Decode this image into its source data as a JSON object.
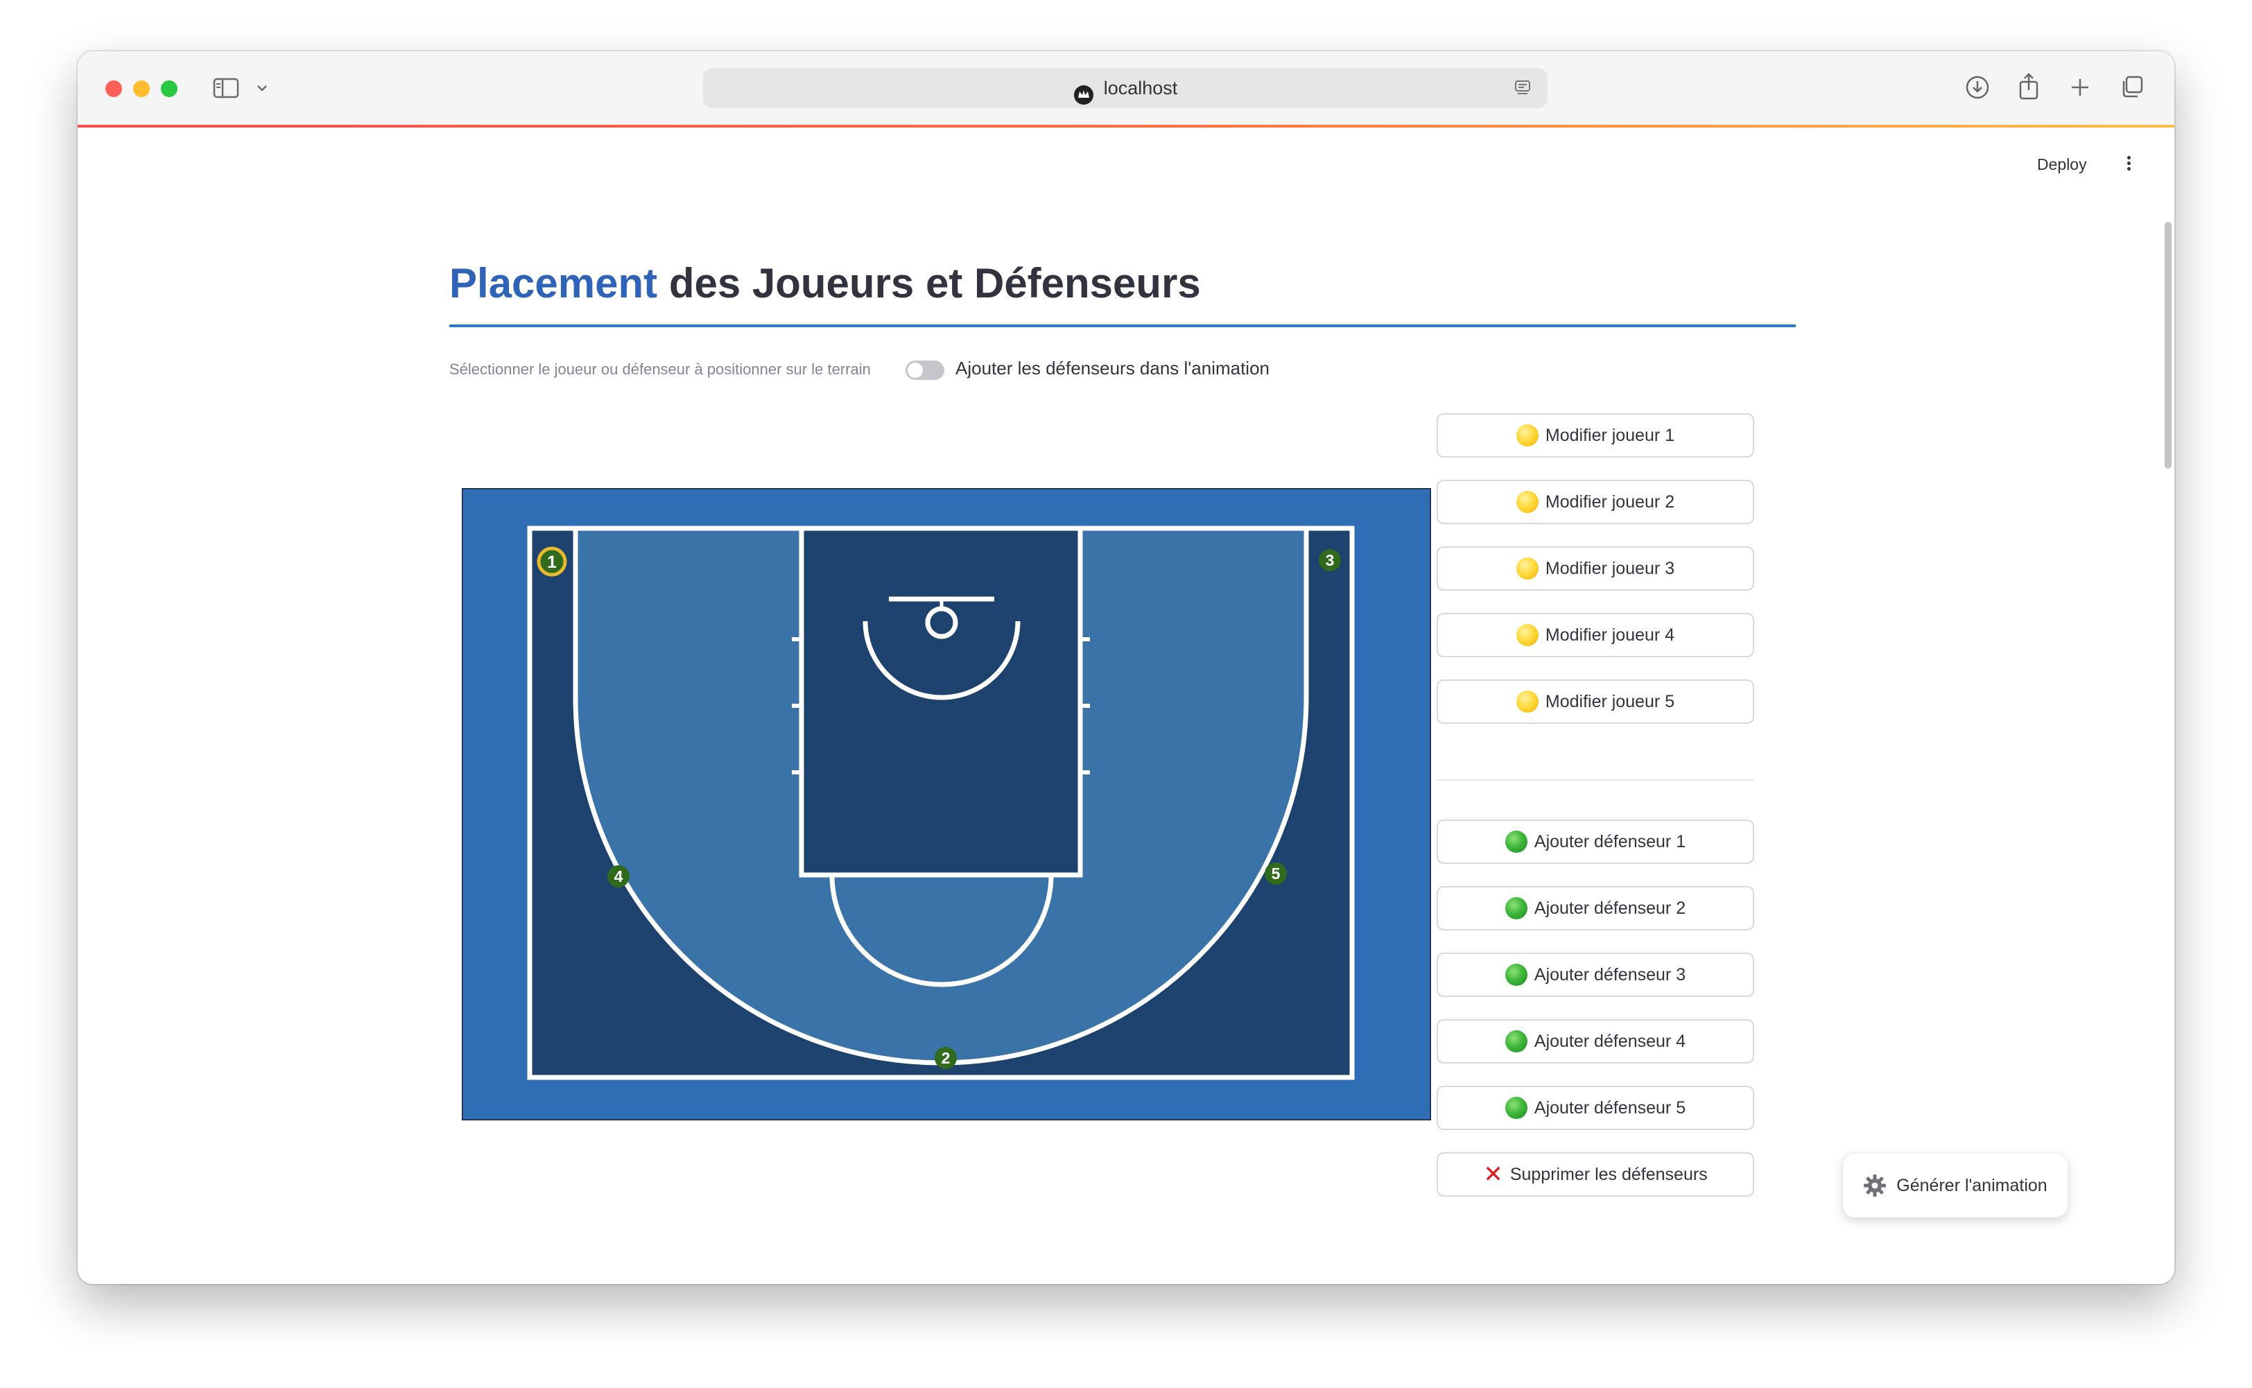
{
  "browser": {
    "url": "localhost"
  },
  "app": {
    "deploy_label": "Deploy"
  },
  "page": {
    "title_accent": "Placement",
    "title_rest": " des Joueurs et Défenseurs",
    "select_label": "Sélectionner le joueur ou défenseur à positionner sur le terrain",
    "toggle_label": "Ajouter les défenseurs dans l'animation",
    "toggle_on": false
  },
  "court": {
    "colors": {
      "outer": "#2f6db5",
      "inner": "#1e426e",
      "arc": "#3a73a8",
      "line": "#ffffff"
    },
    "players": [
      {
        "label": "1",
        "selected": true
      },
      {
        "label": "2",
        "selected": false
      },
      {
        "label": "3",
        "selected": false
      },
      {
        "label": "4",
        "selected": false
      },
      {
        "label": "5",
        "selected": false
      }
    ]
  },
  "player_buttons": [
    {
      "label": "Modifier joueur 1",
      "icon": "yellow-circle-icon"
    },
    {
      "label": "Modifier joueur 2",
      "icon": "yellow-circle-icon"
    },
    {
      "label": "Modifier joueur 3",
      "icon": "yellow-circle-icon"
    },
    {
      "label": "Modifier joueur 4",
      "icon": "yellow-circle-icon"
    },
    {
      "label": "Modifier joueur 5",
      "icon": "yellow-circle-icon"
    }
  ],
  "defender_buttons": [
    {
      "label": "Ajouter défenseur 1",
      "icon": "green-circle-icon"
    },
    {
      "label": "Ajouter défenseur 2",
      "icon": "green-circle-icon"
    },
    {
      "label": "Ajouter défenseur 3",
      "icon": "green-circle-icon"
    },
    {
      "label": "Ajouter défenseur 4",
      "icon": "green-circle-icon"
    },
    {
      "label": "Ajouter défenseur 5",
      "icon": "green-circle-icon"
    }
  ],
  "remove_button": {
    "label": "Supprimer les défenseurs",
    "icon": "red-x-icon"
  },
  "generate_button": {
    "label": "Générer l'animation",
    "icon": "gear-icon"
  }
}
